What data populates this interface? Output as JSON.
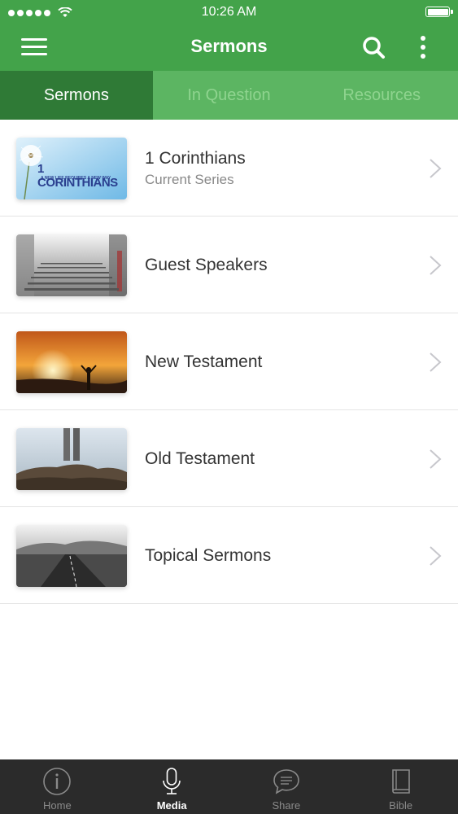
{
  "status": {
    "time": "10:26 AM"
  },
  "header": {
    "title": "Sermons"
  },
  "tabs": [
    {
      "label": "Sermons",
      "active": true
    },
    {
      "label": "In Question",
      "active": false
    },
    {
      "label": "Resources",
      "active": false
    }
  ],
  "series": [
    {
      "title": "1 Corinthians",
      "subtitle": "Current Series",
      "thumb_title": "1 CORINTHIANS",
      "thumb_tagline": "A NEW LIFE REQUIRES A NEW WAY",
      "icon": "dandelion-thumbnail"
    },
    {
      "title": "Guest Speakers",
      "icon": "stairs-thumbnail"
    },
    {
      "title": "New Testament",
      "icon": "sunset-thumbnail"
    },
    {
      "title": "Old Testament",
      "icon": "rocks-thumbnail"
    },
    {
      "title": "Topical Sermons",
      "icon": "road-thumbnail"
    }
  ],
  "bottom_nav": [
    {
      "label": "Home",
      "icon": "info-icon",
      "active": false
    },
    {
      "label": "Media",
      "icon": "microphone-icon",
      "active": true
    },
    {
      "label": "Share",
      "icon": "chat-bubble-icon",
      "active": false
    },
    {
      "label": "Bible",
      "icon": "book-icon",
      "active": false
    }
  ],
  "colors": {
    "primary": "#43a34a",
    "tab_active": "#2f7a36",
    "tab_bar": "#2b2b2b"
  }
}
